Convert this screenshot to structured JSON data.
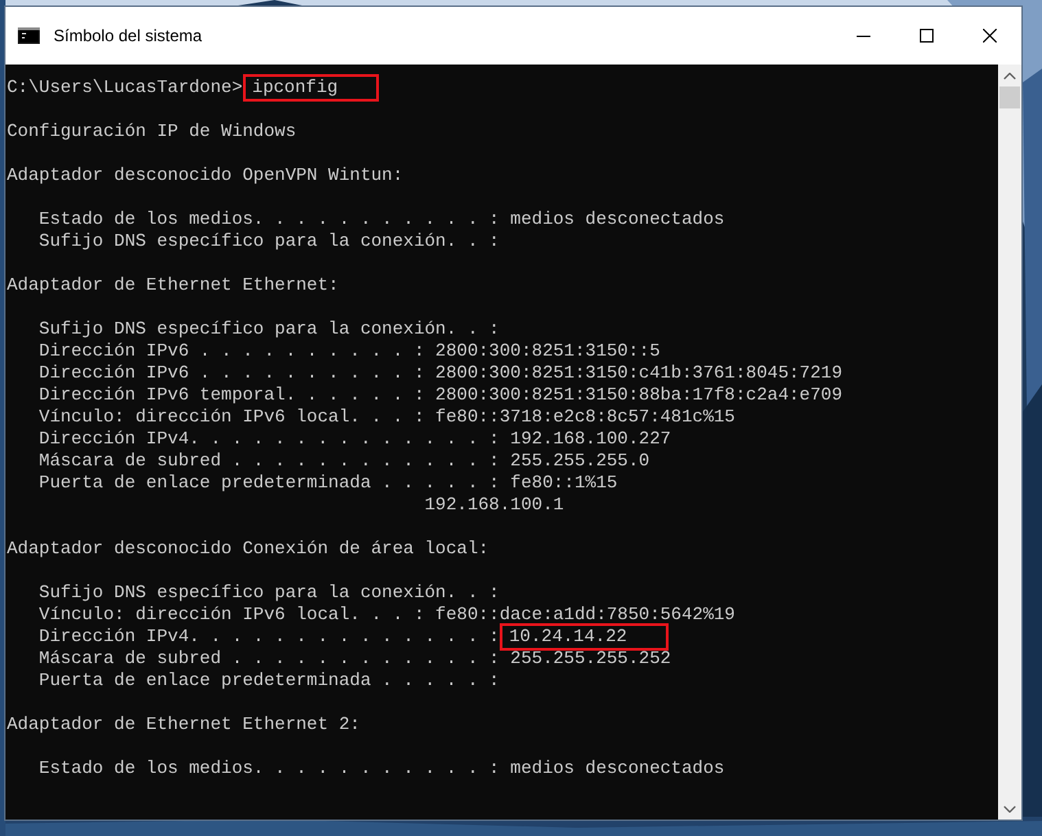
{
  "window": {
    "title": "Símbolo del sistema"
  },
  "console": {
    "blocks": [
      [
        {
          "text": "C:\\Users\\LucasTardone>",
          "marked_text": "ipconfig",
          "marked": true
        }
      ],
      [
        {
          "text": "Configuración IP de Windows"
        }
      ],
      [
        {
          "text": "Adaptador desconocido OpenVPN Wintun:"
        }
      ],
      [
        {
          "text": "   Estado de los medios. . . . . . . . . . . : medios desconectados"
        },
        {
          "text": "   Sufijo DNS específico para la conexión. . :"
        }
      ],
      [
        {
          "text": "Adaptador de Ethernet Ethernet:"
        }
      ],
      [
        {
          "text": "   Sufijo DNS específico para la conexión. . :"
        },
        {
          "text": "   Dirección IPv6 . . . . . . . . . . : 2800:300:8251:3150::5"
        },
        {
          "text": "   Dirección IPv6 . . . . . . . . . . : 2800:300:8251:3150:c41b:3761:8045:7219"
        },
        {
          "text": "   Dirección IPv6 temporal. . . . . . : 2800:300:8251:3150:88ba:17f8:c2a4:e709"
        },
        {
          "text": "   Vínculo: dirección IPv6 local. . . : fe80::3718:e2c8:8c57:481c%15"
        },
        {
          "text": "   Dirección IPv4. . . . . . . . . . . . . . : 192.168.100.227"
        },
        {
          "text": "   Máscara de subred . . . . . . . . . . . . : 255.255.255.0"
        },
        {
          "text": "   Puerta de enlace predeterminada . . . . . : fe80::1%15"
        },
        {
          "text": "                                       192.168.100.1"
        }
      ],
      [
        {
          "text": "Adaptador desconocido Conexión de área local:"
        }
      ],
      [
        {
          "text": "   Sufijo DNS específico para la conexión. . :"
        },
        {
          "text": "   Vínculo: dirección IPv6 local. . . : fe80::dace:a1dd:7850:5642%19"
        },
        {
          "text": "   Dirección IPv4. . . . . . . . . . . . . . :",
          "marked_text": "10.24.14.22",
          "marked": true
        },
        {
          "text": "   Máscara de subred . . . . . . . . . . . . : 255.255.255.252"
        },
        {
          "text": "   Puerta de enlace predeterminada . . . . . :"
        }
      ],
      [
        {
          "text": "Adaptador de Ethernet Ethernet 2:"
        }
      ],
      [
        {
          "text": "   Estado de los medios. . . . . . . . . . . : medios desconectados"
        }
      ]
    ]
  }
}
